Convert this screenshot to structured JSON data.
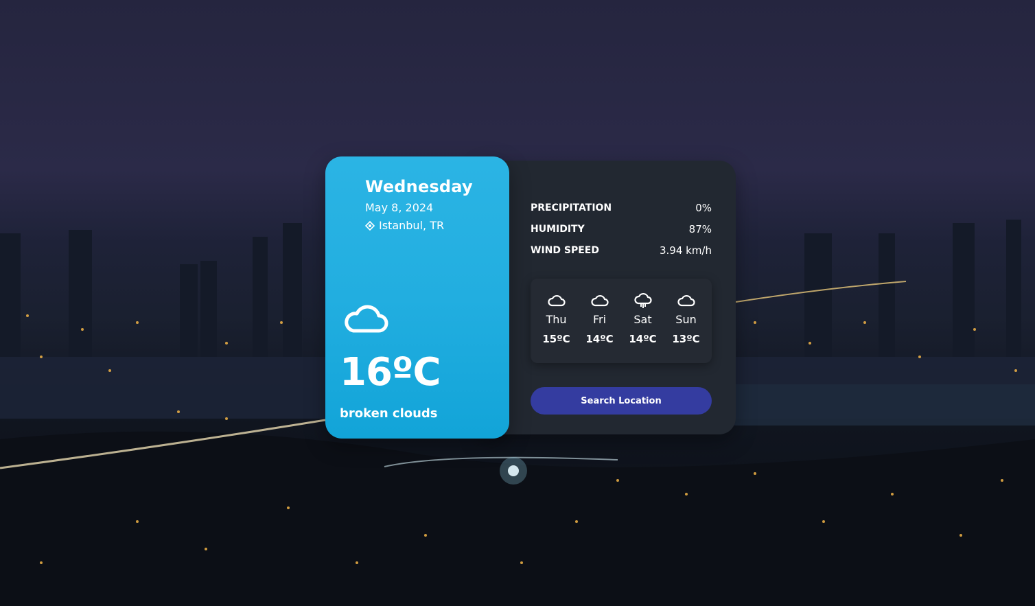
{
  "current": {
    "day": "Wednesday",
    "date": "May 8, 2024",
    "location": "Istanbul, TR",
    "icon": "cloud-icon",
    "temperature": "16ºC",
    "description": "broken clouds"
  },
  "stats": [
    {
      "label": "PRECIPITATION",
      "value": "0%"
    },
    {
      "label": "HUMIDITY",
      "value": "87%"
    },
    {
      "label": "WIND SPEED",
      "value": "3.94 km/h"
    }
  ],
  "forecast": [
    {
      "day": "Thu",
      "temp": "15ºC",
      "icon": "cloud-icon"
    },
    {
      "day": "Fri",
      "temp": "14ºC",
      "icon": "cloud-icon"
    },
    {
      "day": "Sat",
      "temp": "14ºC",
      "icon": "rain-cloud-icon"
    },
    {
      "day": "Sun",
      "temp": "13ºC",
      "icon": "cloud-icon"
    }
  ],
  "search_label": "Search Location",
  "colors": {
    "left_card": "#22aee0",
    "right_card": "#222831",
    "button": "#343ca0"
  }
}
